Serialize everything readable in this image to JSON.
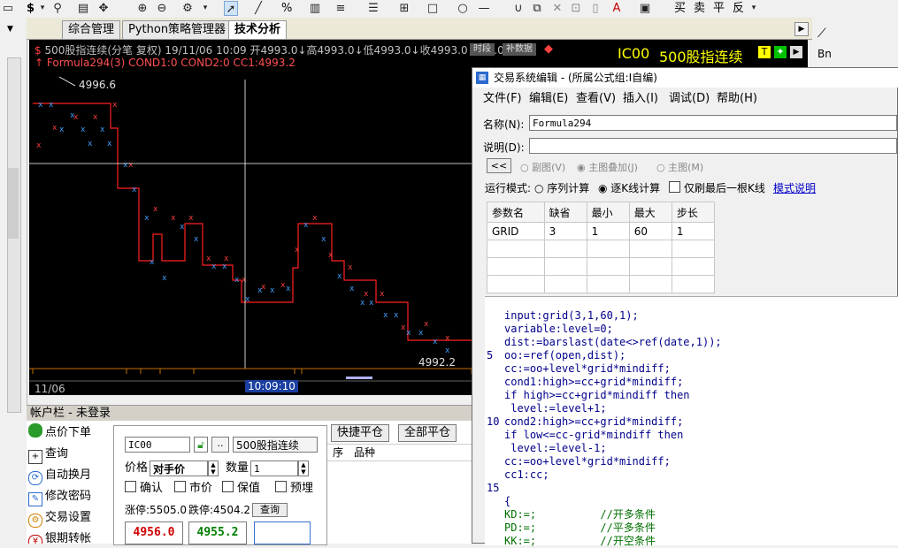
{
  "toolbar": {
    "dollar": "$",
    "percent": "%",
    "buy": "买",
    "sell": "卖",
    "close": "平",
    "reverse": "反"
  },
  "tabs": [
    {
      "label": "综合管理"
    },
    {
      "label": "Python策略管理器"
    },
    {
      "label": "技术分析"
    }
  ],
  "chart": {
    "info_line1": "500股指连续(分笔 复权) 19/11/06 10:09 开4993.0↓高4993.0↓低4993.0↓收4993.0↓换0.00",
    "info_line2": "Formula294(3) COND1:0  COND2:0  CC1:4993.2",
    "badge_time": "时段",
    "badge_data": "补数据",
    "contract": "IC00",
    "contract_name": "500股指连续",
    "high_label": "4996.6",
    "low_label": "4992.2",
    "date_label": "11/06",
    "cursor_time": "10:09:10",
    "right_btn_T": "T",
    "right_btn_arrow": "✦"
  },
  "account": {
    "title": "帐户栏 - 未登录",
    "menu": [
      {
        "label": "点价下单"
      },
      {
        "label": "查询"
      },
      {
        "label": "自动换月"
      },
      {
        "label": "修改密码"
      },
      {
        "label": "交易设置"
      },
      {
        "label": "银期转帐"
      }
    ],
    "code": "IC00",
    "name": "500股指连续",
    "price_label": "价格",
    "price_value": "对手价",
    "qty_label": "数量",
    "qty_value": "1",
    "confirm": "确认",
    "market": "市价",
    "keep": "保值",
    "preorder": "预埋",
    "limit_up": "涨停:5505.0",
    "limit_down": "跌停:4504.2",
    "query_btn": "查询",
    "bid_price": "4956.0",
    "ask_price": "4955.2",
    "quick_close": "快捷平仓",
    "close_all": "全部平仓",
    "col_seq": "序",
    "col_item": "品种"
  },
  "dialog": {
    "title": "交易系统编辑 - (所属公式组:I自编)",
    "menu": [
      "文件(F)",
      "编辑(E)",
      "查看(V)",
      "插入(I)",
      "调试(D)",
      "帮助(H)"
    ],
    "name_label": "名称(N):",
    "name_value": "Formula294",
    "desc_label": "说明(D):",
    "desc_value": "",
    "back_btn": "<<",
    "radio_sub": "副图(V)",
    "radio_main_overlay": "主图叠加(J)",
    "radio_main": "主图(M)",
    "run_mode": "运行模式:",
    "mode_sequence": "序列计算",
    "mode_bar": "逐K线计算",
    "only_last": "仅刷最后一根K线",
    "mode_help": "模式说明",
    "param_headers": [
      "参数名",
      "缺省",
      "最小",
      "最大",
      "步长"
    ],
    "params": [
      {
        "name": "GRID",
        "default": "3",
        "min": "1",
        "max": "60",
        "step": "1"
      }
    ],
    "code_lines": [
      "input:grid(3,1,60,1);",
      "variable:level=0;",
      "dist:=barslast(date<>ref(date,1));",
      "oo:=ref(open,dist);",
      "cc:=oo+level*grid*mindiff;",
      "cond1:high>=cc+grid*mindiff;",
      "if high>=cc+grid*mindiff then",
      " level:=level+1;",
      "cond2:high>=cc+grid*mindiff;",
      "if low<=cc-grid*mindiff then",
      " level:=level-1;",
      "cc:=oo+level*grid*mindiff;",
      "cc1:cc;",
      "",
      "{",
      "KD:=;          //开多条件",
      "PD:=;          //平多条件",
      "KK:=;          //开空条件"
    ],
    "line_numbers": [
      {
        "n": "5",
        "row": 3
      },
      {
        "n": "10",
        "row": 8
      },
      {
        "n": "15",
        "row": 13
      }
    ]
  }
}
